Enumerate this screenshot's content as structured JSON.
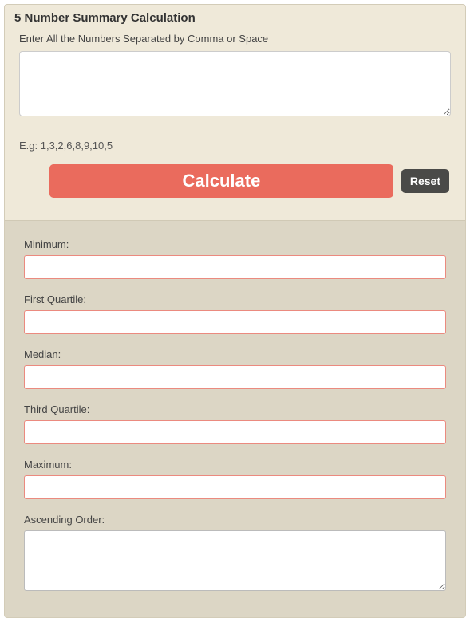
{
  "header": {
    "title": "5 Number Summary Calculation"
  },
  "input": {
    "label": "Enter All the Numbers Separated by Comma or Space",
    "value": "",
    "example": "E.g: 1,3,2,6,8,9,10,5"
  },
  "buttons": {
    "calculate": "Calculate",
    "reset": "Reset"
  },
  "results": {
    "minimum": {
      "label": "Minimum:",
      "value": ""
    },
    "first_quartile": {
      "label": "First Quartile:",
      "value": ""
    },
    "median": {
      "label": "Median:",
      "value": ""
    },
    "third_quartile": {
      "label": "Third Quartile:",
      "value": ""
    },
    "maximum": {
      "label": "Maximum:",
      "value": ""
    },
    "ascending": {
      "label": "Ascending Order:",
      "value": ""
    }
  }
}
